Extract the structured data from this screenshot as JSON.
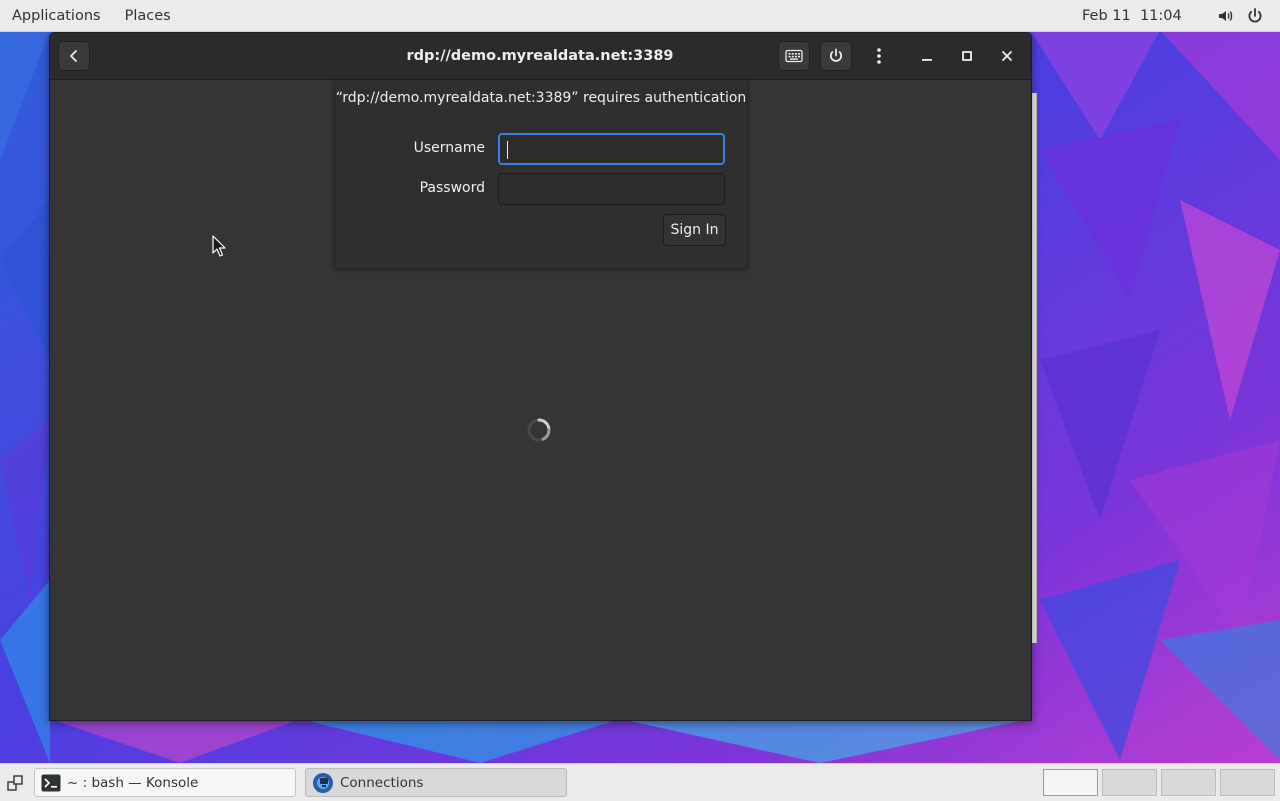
{
  "top_panel": {
    "applications": "Applications",
    "places": "Places",
    "clock": "Feb 11  11:04"
  },
  "window": {
    "title": "rdp://demo.myrealdata.net:3389",
    "auth": {
      "message": "“rdp://demo.myrealdata.net:3389” requires authentication",
      "username_label": "Username",
      "password_label": "Password",
      "username_value": "",
      "password_value": "",
      "signin_label": "Sign In"
    }
  },
  "taskbar": {
    "tasks": [
      {
        "label": "~ : bash — Konsole"
      },
      {
        "label": "Connections"
      }
    ]
  },
  "colors": {
    "accent": "#3584e4",
    "window_bg": "#353535",
    "headerbar_bg": "#2b2b2b"
  },
  "icons": [
    "back-arrow-icon",
    "keyboard-icon",
    "power-icon",
    "kebab-menu-icon",
    "minimize-icon",
    "maximize-icon",
    "close-icon",
    "volume-icon",
    "system-power-icon",
    "terminal-icon",
    "connections-icon",
    "show-desktop-icon",
    "loading-spinner-icon",
    "mouse-pointer-icon"
  ]
}
